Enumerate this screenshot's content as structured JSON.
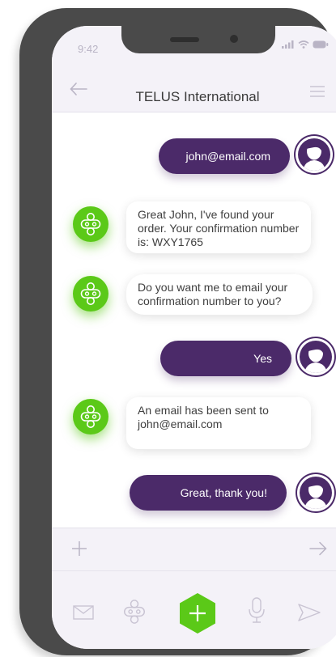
{
  "status": {
    "time": "9:42"
  },
  "header": {
    "title": "TELUS International"
  },
  "messages": [
    {
      "from": "user",
      "text": "john@email.com"
    },
    {
      "from": "bot",
      "text": "Great John, I've found your order. Your confirmation number is: WXY1765"
    },
    {
      "from": "bot",
      "text": "Do you want me to email your confirmation number to you?"
    },
    {
      "from": "user",
      "text": "Yes"
    },
    {
      "from": "bot",
      "text": "An email has been sent to john@email.com"
    },
    {
      "from": "user",
      "text": "Great, thank you!"
    }
  ],
  "input": {
    "value": "",
    "placeholder": ""
  },
  "icons": {
    "back": "arrow-left-icon",
    "menu": "hamburger-menu-icon",
    "attach": "plus-icon",
    "send": "arrow-right-icon",
    "toolbar": [
      "mail-icon",
      "bot-icon",
      "add-hexagon-icon",
      "microphone-icon",
      "send-icon"
    ]
  },
  "colors": {
    "user_bubble": "#4b2a69",
    "bot_green": "#5bc918",
    "background": "#f4f2f8",
    "phone_frame": "#4a4a4a"
  }
}
